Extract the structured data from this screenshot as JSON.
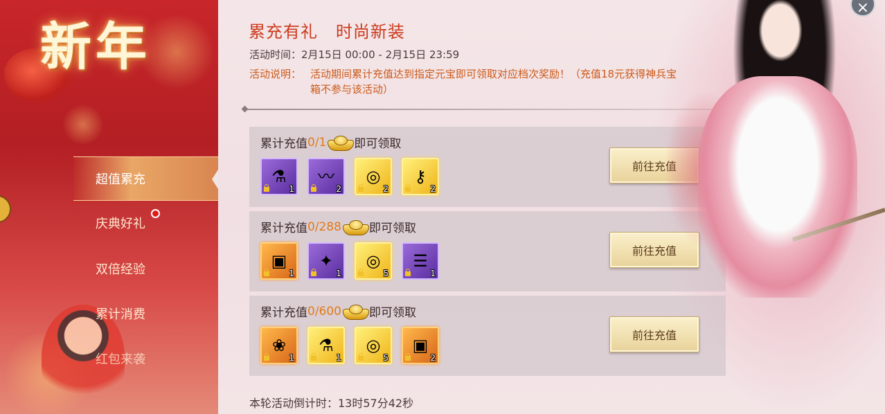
{
  "sidebar": {
    "banner": "新年",
    "items": [
      {
        "label": "超值累充",
        "active": true
      },
      {
        "label": "庆典好礼",
        "badge": true
      },
      {
        "label": "双倍经验"
      },
      {
        "label": "累计消费"
      },
      {
        "label": "红包来袭"
      }
    ]
  },
  "header": {
    "title": "累充有礼   时尚新装",
    "time_line": "活动时间：2月15日 00:00 - 2月15日 23:59",
    "desc_label": "活动说明：",
    "desc_text": "活动期间累计充值达到指定元宝即可领取对应档次奖励！（充值18元获得神兵宝箱不参与该活动）"
  },
  "tiers": [
    {
      "prefix": "累计充值",
      "progress": "0/1",
      "suffix": "即可领取",
      "button": "前往充值",
      "items": [
        {
          "icon": "exp-potion-200-icon",
          "glyph": "⚗",
          "count": "1",
          "rarity": "purple"
        },
        {
          "icon": "green-rope-icon",
          "glyph": "〰",
          "count": "2",
          "rarity": "purple"
        },
        {
          "icon": "purple-orb-icon",
          "glyph": "◎",
          "count": "2",
          "rarity": "gold"
        },
        {
          "icon": "golden-key-icon",
          "glyph": "⚷",
          "count": "2",
          "rarity": "gold"
        }
      ]
    },
    {
      "prefix": "累计充值",
      "progress": "0/288",
      "suffix": "即可领取",
      "button": "前往充值",
      "items": [
        {
          "icon": "treasure-chest-icon",
          "glyph": "▣",
          "count": "1",
          "rarity": "orange"
        },
        {
          "icon": "fish-icon",
          "glyph": "✦",
          "count": "1",
          "rarity": "purple"
        },
        {
          "icon": "purple-orb-icon",
          "glyph": "◎",
          "count": "5",
          "rarity": "gold"
        },
        {
          "icon": "scroll-icon",
          "glyph": "☰",
          "count": "1",
          "rarity": "purple"
        }
      ]
    },
    {
      "prefix": "累计充值",
      "progress": "0/600",
      "suffix": "即可领取",
      "button": "前往充值",
      "items": [
        {
          "icon": "red-pouch-icon",
          "glyph": "❀",
          "count": "1",
          "rarity": "orange"
        },
        {
          "icon": "exp-potion-300-icon",
          "glyph": "⚗",
          "count": "1",
          "rarity": "gold"
        },
        {
          "icon": "purple-orb-icon",
          "glyph": "◎",
          "count": "5",
          "rarity": "gold"
        },
        {
          "icon": "golden-chest-icon",
          "glyph": "▣",
          "count": "2",
          "rarity": "orange"
        }
      ]
    }
  ],
  "countdown": "本轮活动倒计时：13时57分42秒",
  "close_glyph": "×"
}
